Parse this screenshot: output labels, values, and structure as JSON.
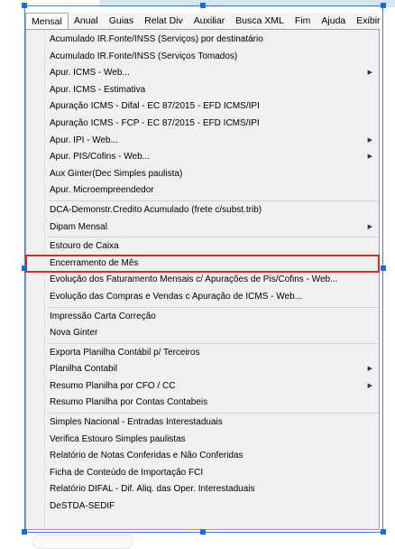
{
  "menubar": {
    "items": [
      {
        "label": "Mensal",
        "active": true
      },
      {
        "label": "Anual"
      },
      {
        "label": "Guias"
      },
      {
        "label": "Relat Div"
      },
      {
        "label": "Auxiliar"
      },
      {
        "label": "Busca XML"
      },
      {
        "label": "Fim"
      },
      {
        "label": "Ajuda"
      },
      {
        "label": "Exibir"
      }
    ]
  },
  "menu": {
    "items": [
      {
        "label": "Acumulado IR.Fonte/INSS (Serviços) por destinatário",
        "submenu": false
      },
      {
        "label": "Acumulado IR.Fonte/INSS (Serviços Tomados)",
        "submenu": false
      },
      {
        "label": "Apur. ICMS - Web...",
        "submenu": true
      },
      {
        "label": "Apur. ICMS - Estimativa",
        "submenu": false
      },
      {
        "label": "Apuração ICMS - Difal - EC 87/2015 - EFD ICMS/IPI",
        "submenu": false
      },
      {
        "label": "Apuração ICMS - FCP - EC 87/2015 - EFD ICMS/IPI",
        "submenu": false
      },
      {
        "label": "Apur. IPI - Web...",
        "submenu": true
      },
      {
        "label": "Apur. PIS/Cofins - Web...",
        "submenu": true
      },
      {
        "label": "Aux Ginter(Dec Simples paulista)",
        "submenu": false
      },
      {
        "label": "Apur. Microempreendedor",
        "submenu": false
      },
      {
        "separator": true
      },
      {
        "label": "DCA-Demonstr.Credito Acumulado (frete c/subst.trib)",
        "submenu": false
      },
      {
        "label": "Dipam Mensal",
        "submenu": true
      },
      {
        "separator": true
      },
      {
        "label": "Estouro de Caixa",
        "submenu": false
      },
      {
        "label": "Encerramento de Mês",
        "submenu": false,
        "highlight": true
      },
      {
        "label": "Evolução dos Faturamento Mensais c/ Apurações de Pis/Cofins - Web...",
        "submenu": false
      },
      {
        "label": "Evolução das Compras e Vendas c Apuração de ICMS - Web...",
        "submenu": false
      },
      {
        "separator": true
      },
      {
        "label": "Impressão Carta Correção",
        "submenu": false
      },
      {
        "label": "Nova Ginter",
        "submenu": false
      },
      {
        "separator": true
      },
      {
        "label": "Exporta Planilha Contábil p/ Terceiros",
        "submenu": false
      },
      {
        "label": "Planilha Contabil",
        "submenu": true
      },
      {
        "label": "Resumo Planilha por CFO / CC",
        "submenu": true
      },
      {
        "label": "Resumo Planilha por Contas Contabeis",
        "submenu": false
      },
      {
        "separator": true
      },
      {
        "label": "Simples Nacional - Entradas Interestaduais",
        "submenu": false
      },
      {
        "label": "Verifica Estouro Simples paulistas",
        "submenu": false
      },
      {
        "label": "Relatório de Notas Conferidas e Não Conferidas",
        "submenu": false
      },
      {
        "label": "Ficha de Conteúdo de Importação FCI",
        "submenu": false
      },
      {
        "label": "Relatório DIFAL - Dif. Aliq. das Oper. Interestaduais",
        "submenu": false
      },
      {
        "label": "DeSTDA-SEDIF",
        "submenu": false
      }
    ]
  },
  "icons": {
    "submenu_arrow": "chevron-right-icon"
  },
  "colors": {
    "highlight_border": "#d12b2b",
    "selection_handle": "#1b6fd1",
    "menu_background": "#f0f0f0"
  }
}
